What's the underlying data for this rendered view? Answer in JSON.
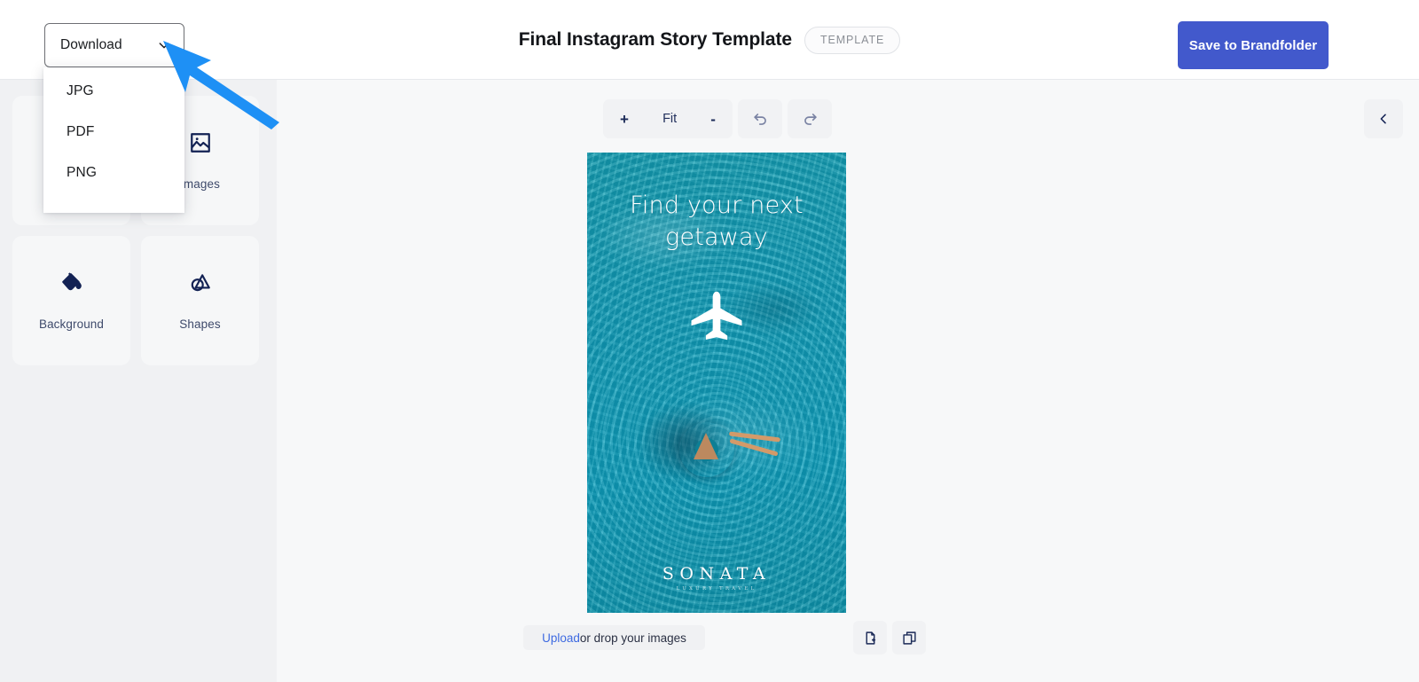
{
  "header": {
    "download_button": {
      "label": "Download",
      "chevron_icon": "chevron-down-icon"
    },
    "document_title": "Final Instagram Story Template",
    "badge": "TEMPLATE",
    "save_button": "Save to Brandfolder"
  },
  "download_menu": {
    "items": [
      {
        "label": "JPG"
      },
      {
        "label": "PDF"
      },
      {
        "label": "PNG"
      }
    ]
  },
  "sidebar": {
    "tools": [
      {
        "label": "",
        "icon": "text-icon"
      },
      {
        "label": "Images",
        "icon": "image-icon"
      },
      {
        "label": "Background",
        "icon": "paint-bucket-icon"
      },
      {
        "label": "Shapes",
        "icon": "shapes-icon"
      }
    ]
  },
  "canvas_toolbar": {
    "zoom_in": "+",
    "zoom_level": "Fit",
    "zoom_out": "-",
    "undo_icon": "undo-icon",
    "redo_icon": "redo-icon",
    "collapse_icon": "chevron-left-icon"
  },
  "artboard": {
    "headline": "Find your next getaway",
    "plane_icon": "airplane-icon",
    "brand_name": "SONATA",
    "brand_tagline": "LUXURY TRAVEL"
  },
  "bottom_bar": {
    "upload_link": "Upload",
    "upload_rest": " or drop your images",
    "add_page_icon": "add-page-icon",
    "duplicate_page_icon": "duplicate-page-icon"
  },
  "colors": {
    "accent_blue": "#4259CC",
    "link_blue": "#3E6AE1",
    "annotation_blue": "#1E90F5",
    "icon_navy": "#132254",
    "sidebar_bg": "#F0F1F3",
    "canvas_bg": "#F7F8F9",
    "artboard_water": "#13A2BB",
    "float_pink": "#E0259F"
  }
}
